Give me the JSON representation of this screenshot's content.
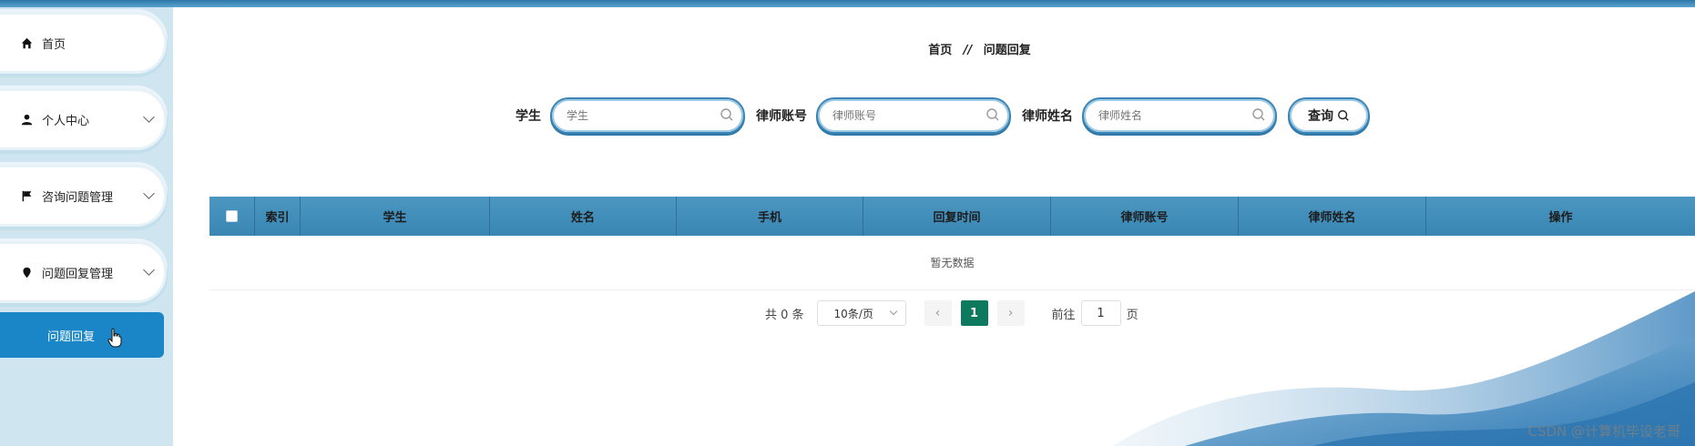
{
  "sidebar": {
    "items": [
      {
        "label": "首页",
        "icon": "home-icon"
      },
      {
        "label": "个人中心",
        "icon": "user-icon"
      },
      {
        "label": "咨询问题管理",
        "icon": "flag-icon"
      },
      {
        "label": "问题回复管理",
        "icon": "pin-icon"
      }
    ],
    "active": "问题回复"
  },
  "breadcrumb": {
    "home": "首页",
    "sep": "//",
    "current": "问题回复"
  },
  "search": {
    "fields": [
      {
        "label": "学生",
        "placeholder": "学生"
      },
      {
        "label": "律师账号",
        "placeholder": "律师账号"
      },
      {
        "label": "律师姓名",
        "placeholder": "律师姓名"
      }
    ],
    "button": "查询"
  },
  "table": {
    "columns": [
      "索引",
      "学生",
      "姓名",
      "手机",
      "回复时间",
      "律师账号",
      "律师姓名",
      "操作"
    ],
    "empty_text": "暂无数据"
  },
  "pagination": {
    "total": "共 0 条",
    "page_size": "10条/页",
    "current": "1",
    "goto_label": "前往",
    "goto_value": "1",
    "page_suffix": "页"
  },
  "watermark": "CSDN @计算机毕设老哥",
  "colors": {
    "accent": "#1a86c8",
    "header": "#3f8cb9",
    "pager_active": "#0d7a5f"
  }
}
